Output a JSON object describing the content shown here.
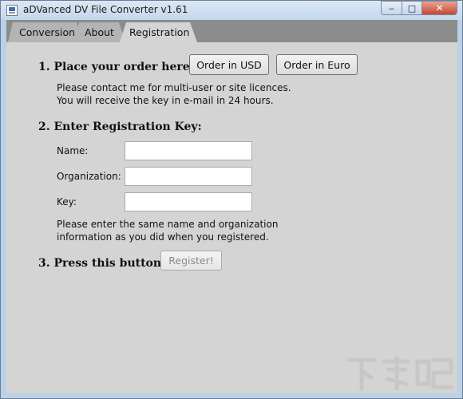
{
  "window": {
    "title": "aDVanced DV File Converter v1.61"
  },
  "caption_buttons": {
    "minimize": "‒",
    "maximize": "□",
    "close": "✕"
  },
  "tabs": [
    {
      "label": "Conversion"
    },
    {
      "label": "About"
    },
    {
      "label": "Registration"
    }
  ],
  "registration": {
    "step1": {
      "heading": "1. Place your order here:",
      "usd_button": "Order in USD",
      "euro_button": "Order in Euro",
      "note_line1": "Please contact me for multi-user or site licences.",
      "note_line2": "You will receive the key in e-mail in 24 hours."
    },
    "step2": {
      "heading": "2. Enter Registration Key:",
      "name_label": "Name:",
      "name_value": "",
      "org_label": "Organization:",
      "org_value": "",
      "key_label": "Key:",
      "key_value": "",
      "note_line1": "Please enter the same name and organization",
      "note_line2": "information as you did when you registered."
    },
    "step3": {
      "heading": "3. Press this button:",
      "register_button": "Register!"
    }
  }
}
